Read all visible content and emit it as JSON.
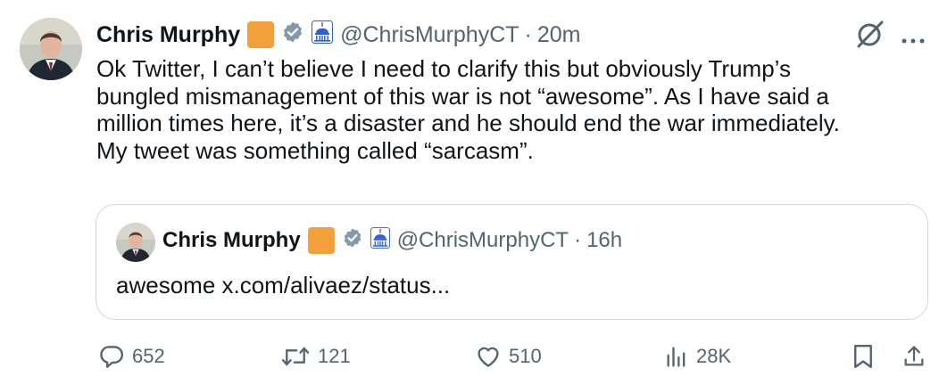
{
  "tweet": {
    "author_name": "Chris Murphy",
    "handle": "@ChrisMurphyCT",
    "separator": "·",
    "time": "20m",
    "text": "Ok Twitter, I can’t believe I need to clarify this but obviously Trump’s\nbungled mismanagement of this war is not “awesome”. As I have said a\nmillion times here, it’s a disaster and he should end the war immediately.\nMy tweet was something called “sarcasm”."
  },
  "quoted_tweet": {
    "author_name": "Chris Murphy",
    "handle": "@ChrisMurphyCT",
    "separator": "·",
    "time": "16h",
    "text": "awesome x.com/alivaez/status..."
  },
  "metrics": {
    "replies": "652",
    "reposts": "121",
    "likes": "510",
    "views": "28K"
  },
  "colors": {
    "text_primary": "#0f1419",
    "text_secondary": "#536471",
    "verified_gray": "#829aab",
    "badge_orange": "#f2a03b",
    "capitol_blue": "#2f5fd0",
    "border": "#cfd9de"
  },
  "icons": {
    "verified": "verified-badge-icon",
    "capitol": "capitol-icon",
    "grok": "grok-icon",
    "more": "more-icon",
    "reply": "reply-icon",
    "repost": "repost-icon",
    "like": "like-icon",
    "views": "views-icon",
    "bookmark": "bookmark-icon",
    "share": "share-icon"
  }
}
